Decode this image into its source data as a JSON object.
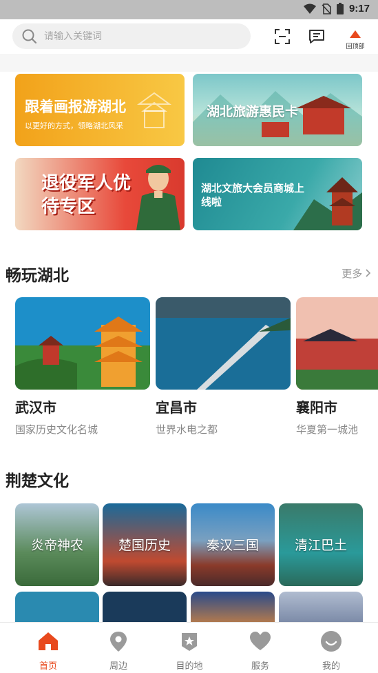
{
  "status_bar": {
    "time": "9:17"
  },
  "search": {
    "placeholder": "请输入关键词"
  },
  "header": {
    "back_top_label": "回顶部"
  },
  "banners": [
    {
      "title": "跟着画报游湖北",
      "subtitle": "以更好的方式，领略湖北风采"
    },
    {
      "title": "湖北旅游惠民卡"
    },
    {
      "title": "退役军人优待专区"
    },
    {
      "title": "湖北文旅大会员商城上线啦"
    }
  ],
  "section_play": {
    "title": "畅玩湖北",
    "more": "更多",
    "cities": [
      {
        "name": "武汉市",
        "desc": "国家历史文化名城"
      },
      {
        "name": "宜昌市",
        "desc": "世界水电之都"
      },
      {
        "name": "襄阳市",
        "desc": "华夏第一城池"
      }
    ]
  },
  "section_culture": {
    "title": "荆楚文化",
    "items": [
      "炎帝神农",
      "楚国历史",
      "秦汉三国",
      "清江巴土"
    ]
  },
  "tabbar": {
    "items": [
      {
        "label": "首页",
        "active": true
      },
      {
        "label": "周边"
      },
      {
        "label": "目的地"
      },
      {
        "label": "服务"
      },
      {
        "label": "我的"
      }
    ]
  },
  "colors": {
    "accent": "#e8491d",
    "inactive": "#9a9a9a"
  }
}
